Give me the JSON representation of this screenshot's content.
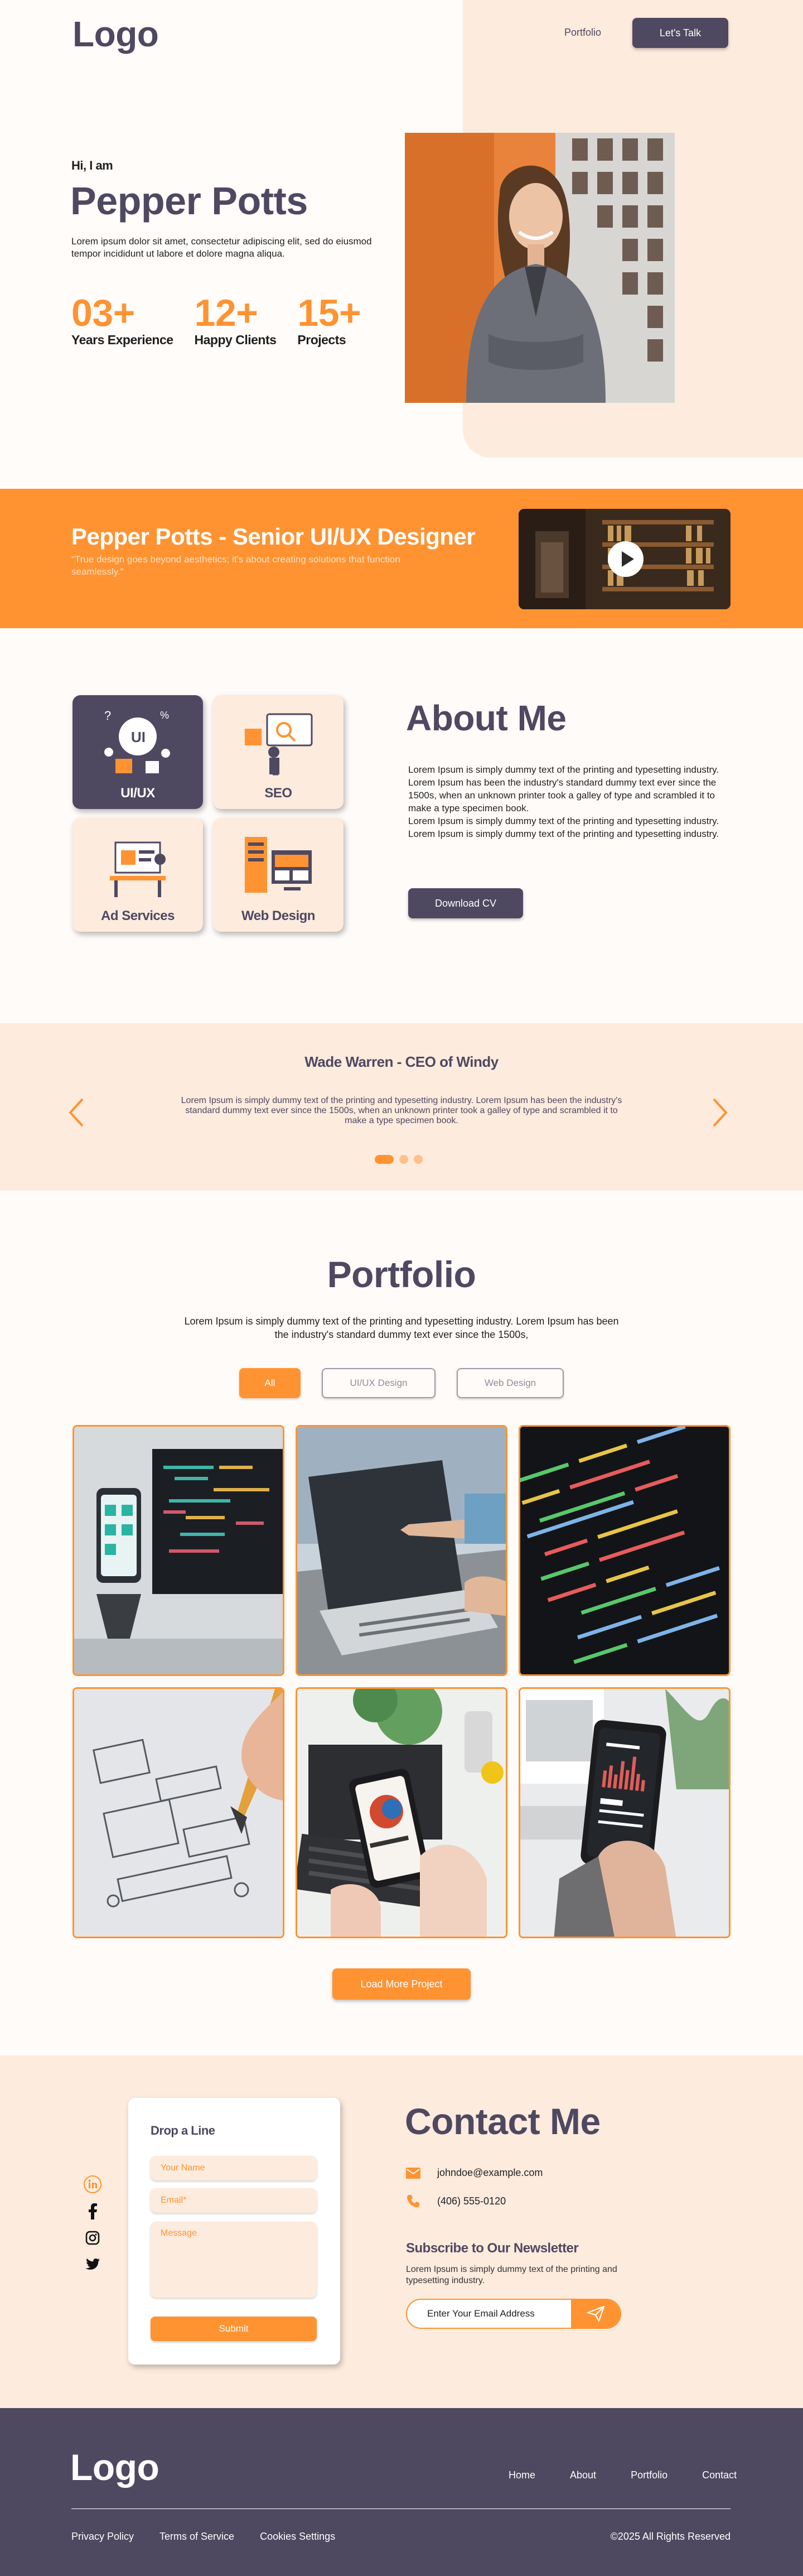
{
  "header": {
    "logo": "Logo",
    "nav_link": "Portfolio",
    "cta": "Let's Talk"
  },
  "hero": {
    "greeting": "Hi, I am",
    "name": "Pepper Potts",
    "description": "Lorem ipsum dolor sit amet, consectetur adipiscing elit, sed do eiusmod tempor incididunt ut labore et dolore magna aliqua.",
    "stats": [
      {
        "value": "03+",
        "label": "Years Experience"
      },
      {
        "value": "12+",
        "label": "Happy Clients"
      },
      {
        "value": "15+",
        "label": "Projects"
      }
    ]
  },
  "banner": {
    "title": "Pepper Potts - Senior UI/UX Designer",
    "quote": "\"True design goes beyond aesthetics; it's about creating solutions that function seamlessly.\""
  },
  "about": {
    "title": "About Me",
    "services": [
      "UI/UX",
      "SEO",
      "Ad Services",
      "Web Design"
    ],
    "text": "Lorem Ipsum is simply dummy text of the printing and typesetting industry. Lorem Ipsum has been the industry's standard dummy text ever since the 1500s, when an unknown printer took a galley of type and scrambled it to make a type specimen book.\nLorem Ipsum is simply dummy text of the printing and typesetting industry.\nLorem Ipsum is simply dummy text of the printing and typesetting industry.",
    "cv_button": "Download CV"
  },
  "testimonial": {
    "author": "Wade Warren - CEO of Windy",
    "text": "Lorem Ipsum is simply dummy text of the printing and typesetting industry. Lorem Ipsum has been the industry's standard dummy text ever since the 1500s, when an unknown printer took a galley of type and scrambled it to make a type specimen book.",
    "active_slide": 1,
    "slide_count": 3
  },
  "portfolio": {
    "title": "Portfolio",
    "description": "Lorem Ipsum is simply dummy text of the printing and typesetting industry. Lorem Ipsum has been the industry's standard dummy text ever since the 1500s,",
    "filters": [
      "All",
      "UI/UX Design",
      "Web Design"
    ],
    "active_filter": "All",
    "load_more": "Load More Project"
  },
  "contact": {
    "form_title": "Drop a Line",
    "name_placeholder": "Your Name",
    "email_placeholder": "Email*",
    "message_placeholder": "Message",
    "submit": "Submit",
    "title": "Contact Me",
    "email": "johndoe@example.com",
    "phone": "(406) 555-0120",
    "newsletter_title": "Subscribe to Our Newsletter",
    "newsletter_desc": "Lorem Ipsum is simply dummy text of the printing and typesetting industry.",
    "newsletter_placeholder": "Enter Your Email Address",
    "socials": [
      "linkedin-icon",
      "facebook-icon",
      "instagram-icon",
      "twitter-icon"
    ]
  },
  "footer": {
    "logo": "Logo",
    "nav": [
      "Home",
      "About",
      "Portfolio",
      "Contact"
    ],
    "legal": [
      "Privacy Policy",
      "Terms of Service",
      "Cookies Settings"
    ],
    "copyright": "©2025 All Rights Reserved"
  },
  "colors": {
    "accent": "#FF9332",
    "primary": "#4F4861",
    "cream": "#FDEBDD"
  }
}
